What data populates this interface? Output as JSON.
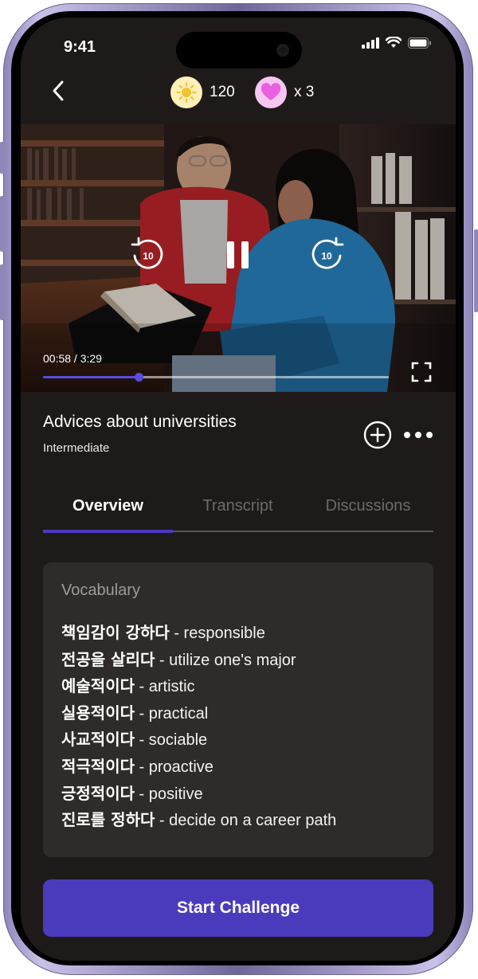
{
  "status_bar": {
    "time": "9:41"
  },
  "top_bar": {
    "back_icon": "chevron-left-icon",
    "coins": {
      "icon": "sun-icon",
      "value": "120"
    },
    "hearts": {
      "icon": "heart-icon",
      "value": "x 3"
    }
  },
  "video": {
    "elapsed": "00:58",
    "duration": "3:29",
    "time_label": "00:58 / 3:29",
    "progress": 0.277,
    "rewind_label": "10",
    "forward_label": "10",
    "state": "playing"
  },
  "lesson": {
    "title": "Advices about universities",
    "level": "Intermediate"
  },
  "tabs": [
    {
      "label": "Overview",
      "active": true
    },
    {
      "label": "Transcript",
      "active": false
    },
    {
      "label": "Discussions",
      "active": false
    }
  ],
  "vocabulary": {
    "title": "Vocabulary",
    "items": [
      {
        "ko": "책임감이 강하다",
        "en": " - responsible"
      },
      {
        "ko": "전공을 살리다",
        "en": " - utilize one's major"
      },
      {
        "ko": "예술적이다",
        "en": " - artistic"
      },
      {
        "ko": "실용적이다",
        "en": " - practical"
      },
      {
        "ko": "사교적이다",
        "en": " - sociable"
      },
      {
        "ko": "적극적이다",
        "en": " - proactive"
      },
      {
        "ko": "긍정적이다",
        "en": " - positive"
      },
      {
        "ko": "진로를 정하다",
        "en": " - decide on a career path"
      }
    ]
  },
  "cta": {
    "label": "Start Challenge"
  },
  "colors": {
    "background": "#1f1a1a",
    "accent": "#4a3bbd",
    "card": "#2f2b2b"
  }
}
